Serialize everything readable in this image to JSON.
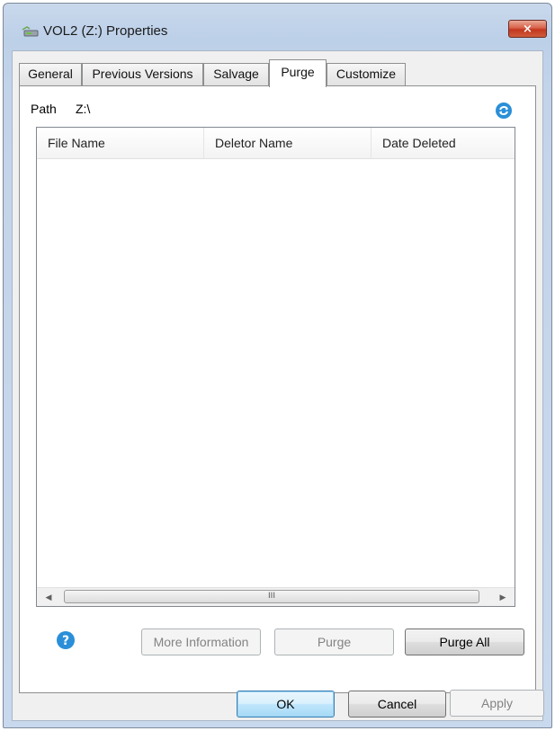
{
  "window": {
    "title": "VOL2 (Z:) Properties",
    "close_glyph": "×"
  },
  "tabs": [
    {
      "label": "General"
    },
    {
      "label": "Previous Versions"
    },
    {
      "label": "Salvage"
    },
    {
      "label": "Purge"
    },
    {
      "label": "Customize"
    }
  ],
  "active_tab": "Purge",
  "path": {
    "label": "Path",
    "value": "Z:\\"
  },
  "list": {
    "columns": [
      "File Name",
      "Deletor Name",
      "Date Deleted"
    ],
    "rows": [],
    "scroll_grip": "III"
  },
  "actions": {
    "more_info": "More Information",
    "purge": "Purge",
    "purge_all": "Purge All"
  },
  "footer": {
    "ok": "OK",
    "cancel": "Cancel",
    "apply": "Apply"
  },
  "colors": {
    "accent_blue": "#2a8fd8",
    "close_red": "#c7432b"
  },
  "icons": {
    "title": "drive-network-icon",
    "refresh": "refresh-icon",
    "help": "help-icon"
  }
}
